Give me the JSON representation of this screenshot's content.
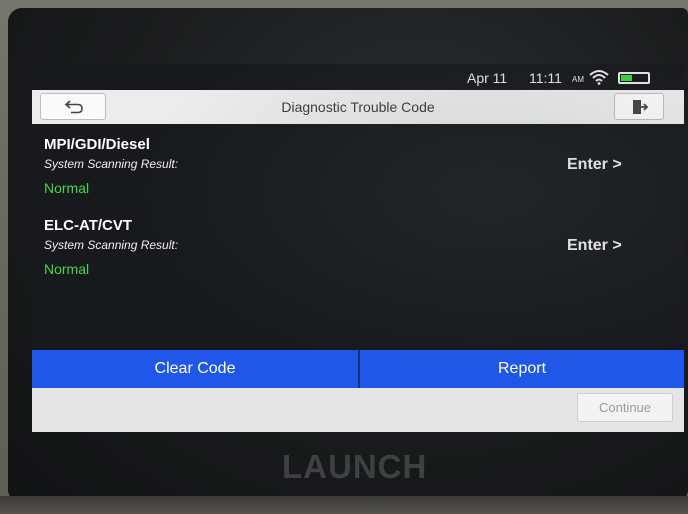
{
  "status": {
    "date": "Apr 11",
    "time": "11:11",
    "ampm": "AM"
  },
  "header": {
    "title": "Diagnostic Trouble Code"
  },
  "systems": [
    {
      "name": "MPI/GDI/Diesel",
      "label": "System Scanning Result:",
      "status": "Normal",
      "action": "Enter >"
    },
    {
      "name": "ELC-AT/CVT",
      "label": "System Scanning Result:",
      "status": "Normal",
      "action": "Enter >"
    }
  ],
  "actions": {
    "clear": "Clear Code",
    "report": "Report",
    "continue": "Continue"
  },
  "device": {
    "brand": "LAUNCH"
  },
  "icons": {
    "back": "back-arrow-icon",
    "exit": "exit-icon",
    "wifi": "wifi-icon",
    "battery": "battery-icon"
  },
  "colors": {
    "accent": "#1f57e8",
    "status_ok": "#4ad64a",
    "title_bar": "#ececec"
  }
}
